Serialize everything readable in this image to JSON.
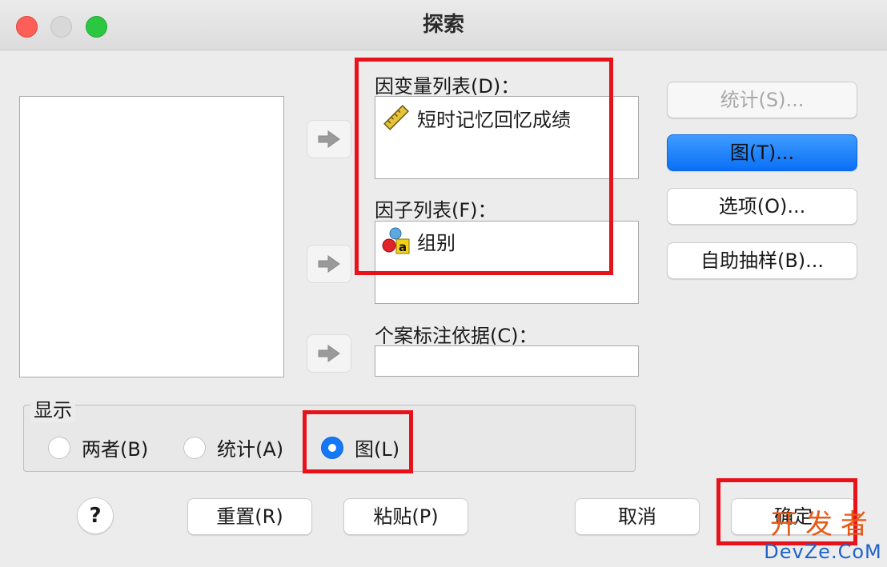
{
  "window": {
    "title": "探索"
  },
  "dependent_list": {
    "label": "因变量列表(D)：",
    "items": [
      {
        "text": "短时记忆回忆成绩",
        "icon": "scale-ruler-icon"
      }
    ]
  },
  "factor_list": {
    "label": "因子列表(F)：",
    "items": [
      {
        "text": "组别",
        "icon": "nominal-variable-icon"
      }
    ]
  },
  "case_label": {
    "label": "个案标注依据(C)："
  },
  "side_buttons": {
    "statistics": "统计(S)...",
    "plots": "图(T)...",
    "options": "选项(O)...",
    "bootstrap": "自助抽样(B)..."
  },
  "display": {
    "title": "显示",
    "options": [
      "两者(B)",
      "统计(A)",
      "图(L)"
    ],
    "selected": "图(L)"
  },
  "footer": {
    "help": "?",
    "reset": "重置(R)",
    "paste": "粘贴(P)",
    "cancel": "取消",
    "ok": "确定"
  },
  "watermark": {
    "cn": "开发者",
    "en": "DevZe.CoM"
  },
  "colors": {
    "highlight_box": "#e8121b",
    "accent": "#1478f7"
  }
}
